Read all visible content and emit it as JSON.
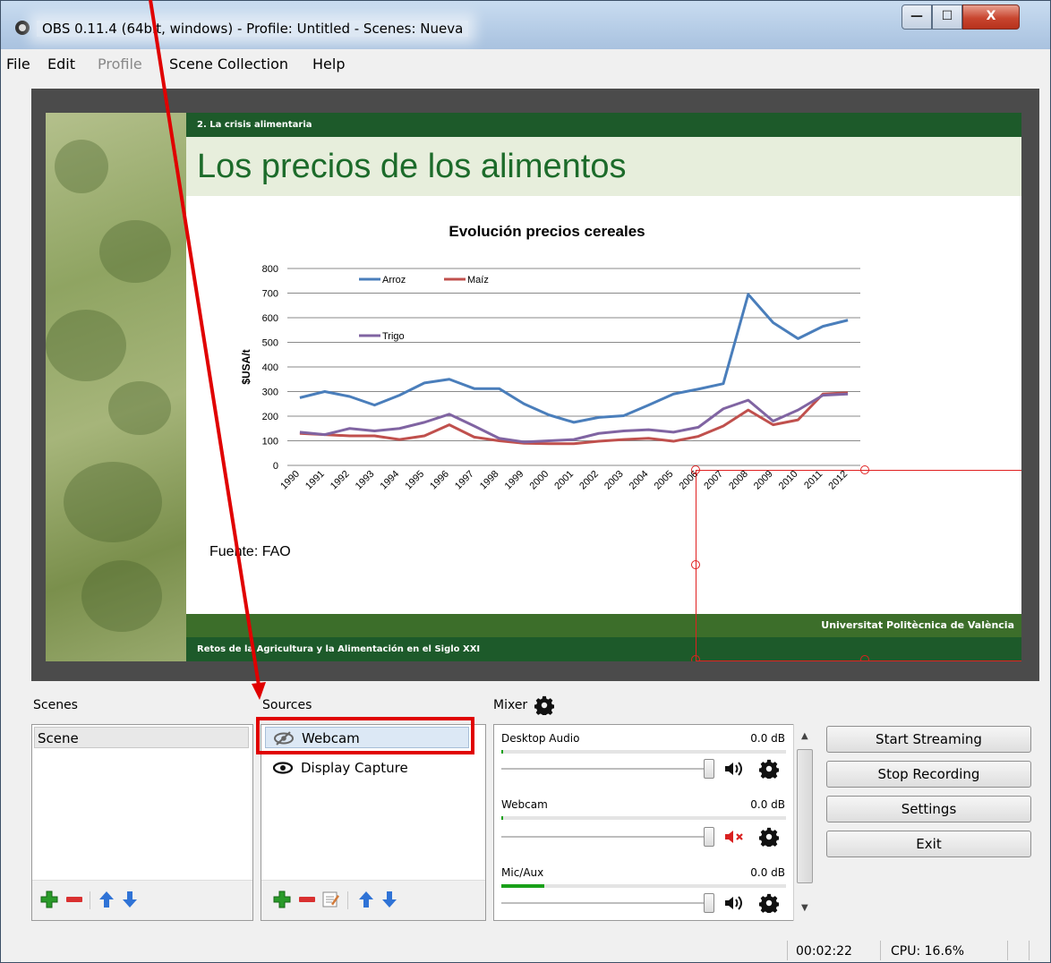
{
  "window": {
    "title": "OBS 0.11.4 (64bit, windows) - Profile: Untitled - Scenes: Nueva",
    "min_glyph": "—",
    "max_glyph": "☐",
    "close_glyph": "X"
  },
  "menu": {
    "file": "File",
    "edit": "Edit",
    "profile": "Profile",
    "scene_collection": "Scene Collection",
    "help": "Help"
  },
  "slide": {
    "section": "2. La crisis alimentaria",
    "title": "Los precios de los alimentos",
    "source_note": "Fuente: FAO",
    "footer_right": "Universitat Politècnica de València",
    "footer_left": "Retos de la Agricultura y la Alimentación en el Siglo XXI"
  },
  "chart_data": {
    "type": "line",
    "title": "Evolución precios cereales",
    "xlabel": "",
    "ylabel": "$USA/t",
    "ylim": [
      0,
      800
    ],
    "yticks": [
      0,
      100,
      200,
      300,
      400,
      500,
      600,
      700,
      800
    ],
    "grid": true,
    "categories": [
      "1990",
      "1991",
      "1992",
      "1993",
      "1994",
      "1995",
      "1996",
      "1997",
      "1998",
      "1999",
      "2000",
      "2001",
      "2002",
      "2003",
      "2004",
      "2005",
      "2006",
      "2007",
      "2008",
      "2009",
      "2010",
      "2011",
      "2012"
    ],
    "series": [
      {
        "name": "Arroz",
        "color": "#4a7ebb",
        "values": [
          275,
          300,
          280,
          245,
          285,
          335,
          350,
          312,
          312,
          250,
          205,
          175,
          195,
          202,
          245,
          290,
          310,
          332,
          695,
          580,
          515,
          565,
          590
        ]
      },
      {
        "name": "Maíz",
        "color": "#c0504d",
        "values": [
          130,
          125,
          120,
          120,
          105,
          120,
          165,
          115,
          100,
          90,
          88,
          88,
          98,
          105,
          110,
          98,
          118,
          160,
          225,
          165,
          185,
          290,
          295
        ]
      },
      {
        "name": "Trigo",
        "color": "#8064a2",
        "values": [
          135,
          125,
          150,
          140,
          150,
          175,
          208,
          160,
          110,
          95,
          100,
          105,
          130,
          140,
          145,
          135,
          155,
          230,
          265,
          180,
          225,
          285,
          290
        ]
      }
    ],
    "legend_placement": "top-left"
  },
  "panels": {
    "scenes_label": "Scenes",
    "sources_label": "Sources",
    "mixer_label": "Mixer"
  },
  "scenes": [
    {
      "name": "Scene"
    }
  ],
  "sources": [
    {
      "name": "Webcam",
      "visible": false,
      "icon": "eye-hidden-icon"
    },
    {
      "name": "Display Capture",
      "visible": true,
      "icon": "eye-icon"
    }
  ],
  "mixer": {
    "channels": [
      {
        "name": "Desktop Audio",
        "db": "0.0 dB",
        "level": 0.0,
        "muted": false
      },
      {
        "name": "Webcam",
        "db": "0.0 dB",
        "level": 0.0,
        "muted": true
      },
      {
        "name": "Mic/Aux",
        "db": "0.0 dB",
        "level": 0.15,
        "muted": false
      }
    ]
  },
  "buttons": {
    "start_streaming": "Start Streaming",
    "stop_recording": "Stop Recording",
    "settings": "Settings",
    "exit": "Exit"
  },
  "status": {
    "time": "00:02:22",
    "cpu": "CPU: 16.6%"
  },
  "colors": {
    "annotation": "#e00000",
    "add": "#2a9a2a",
    "remove": "#d93030",
    "arrow": "#2f73d6"
  }
}
